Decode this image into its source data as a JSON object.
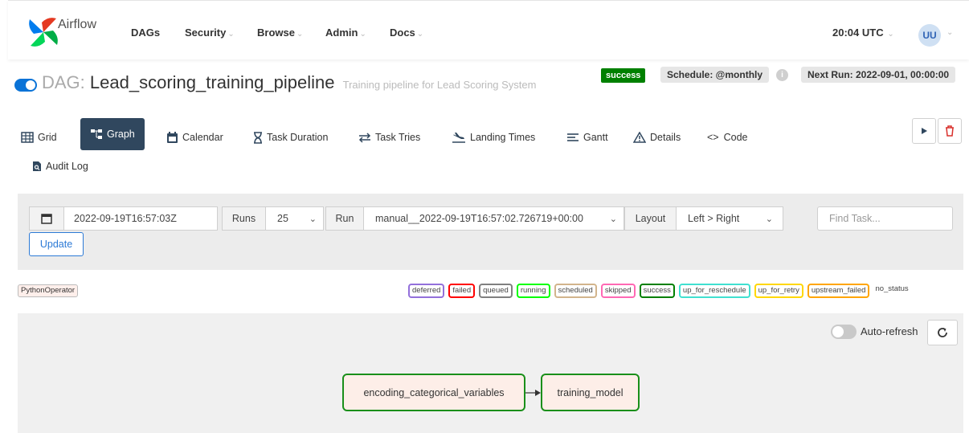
{
  "navbar": {
    "brand": "Airflow",
    "items": [
      {
        "label": "DAGs",
        "has_caret": false
      },
      {
        "label": "Security",
        "has_caret": true
      },
      {
        "label": "Browse",
        "has_caret": true
      },
      {
        "label": "Admin",
        "has_caret": true
      },
      {
        "label": "Docs",
        "has_caret": true
      }
    ],
    "clock": "20:04 UTC",
    "user_initials": "UU"
  },
  "dag": {
    "prefix": "DAG:",
    "name": "Lead_scoring_training_pipeline",
    "description": "Training pipeline for Lead Scoring System",
    "paused": false,
    "last_state": "success",
    "schedule": "Schedule: @monthly",
    "next_run": "Next Run: 2022-09-01, 00:00:00"
  },
  "tabs": [
    {
      "label": "Grid",
      "icon": "grid-icon",
      "active": false
    },
    {
      "label": "Graph",
      "icon": "graph-icon",
      "active": true
    },
    {
      "label": "Calendar",
      "icon": "calendar-icon",
      "active": false
    },
    {
      "label": "Task Duration",
      "icon": "hourglass-icon",
      "active": false
    },
    {
      "label": "Task Tries",
      "icon": "retry-arrows-icon",
      "active": false
    },
    {
      "label": "Landing Times",
      "icon": "plane-landing-icon",
      "active": false
    },
    {
      "label": "Gantt",
      "icon": "gantt-icon",
      "active": false
    },
    {
      "label": "Details",
      "icon": "warning-triangle-icon",
      "active": false
    },
    {
      "label": "Code",
      "icon": "code-icon",
      "active": false
    },
    {
      "label": "Audit Log",
      "icon": "audit-log-icon",
      "active": false
    }
  ],
  "filters": {
    "base_date": "2022-09-19T16:57:03Z",
    "runs_label": "Runs",
    "runs_value": "25",
    "run_label": "Run",
    "run_value": "manual__2022-09-19T16:57:02.726719+00:00",
    "layout_label": "Layout",
    "layout_value": "Left > Right",
    "find_task_placeholder": "Find Task...",
    "update_label": "Update"
  },
  "legend": {
    "operator": "PythonOperator",
    "states": [
      {
        "label": "deferred",
        "color": "#9370db"
      },
      {
        "label": "failed",
        "color": "#ff0000"
      },
      {
        "label": "queued",
        "color": "#808080"
      },
      {
        "label": "running",
        "color": "#00ff00"
      },
      {
        "label": "scheduled",
        "color": "#d2b48c"
      },
      {
        "label": "skipped",
        "color": "#ff69b4"
      },
      {
        "label": "success",
        "color": "#008000"
      },
      {
        "label": "up_for_reschedule",
        "color": "#40e0d0"
      },
      {
        "label": "up_for_retry",
        "color": "#ffd700"
      },
      {
        "label": "upstream_failed",
        "color": "#ffa500"
      },
      {
        "label": "no_status",
        "color": ""
      }
    ]
  },
  "graph": {
    "auto_refresh_label": "Auto-refresh",
    "auto_refresh_on": false,
    "tasks": [
      {
        "label": "encoding_categorical_variables",
        "state": "success"
      },
      {
        "label": "training_model",
        "state": "success"
      }
    ]
  },
  "colors": {
    "primary": "#30475e",
    "success": "#008000",
    "toggle_on": "#0a73d7",
    "operator_fill": "#ffefeb"
  }
}
